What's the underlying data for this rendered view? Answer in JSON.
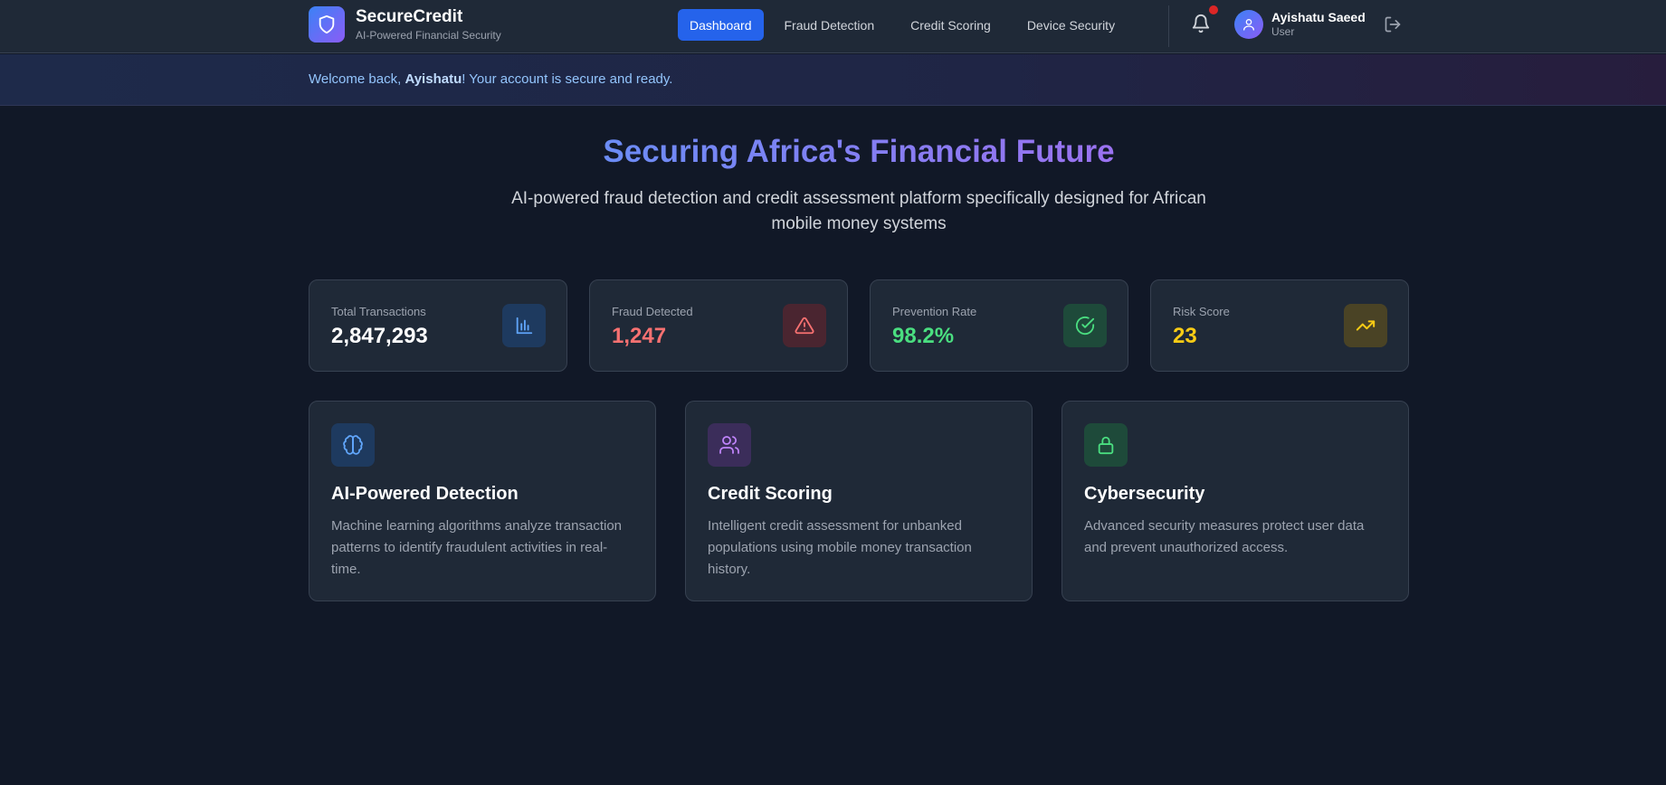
{
  "app": {
    "name": "SecureCredit",
    "tagline": "AI-Powered Financial Security"
  },
  "nav": {
    "items": [
      {
        "label": "Dashboard",
        "active": true
      },
      {
        "label": "Fraud Detection",
        "active": false
      },
      {
        "label": "Credit Scoring",
        "active": false
      },
      {
        "label": "Device Security",
        "active": false
      }
    ]
  },
  "user": {
    "name": "Ayishatu Saeed",
    "role": "User"
  },
  "welcome": {
    "prefix": "Welcome back, ",
    "name": "Ayishatu",
    "suffix": "! Your account is secure and ready."
  },
  "hero": {
    "title": "Securing Africa's Financial Future",
    "subtitle": "AI-powered fraud detection and credit assessment platform specifically designed for African mobile money systems"
  },
  "stats": [
    {
      "label": "Total Transactions",
      "value": "2,847,293",
      "color": "#ffffff",
      "icon": "bar-chart-icon",
      "icon_color": "#60a5fa",
      "icon_bg": "#1e3a5f"
    },
    {
      "label": "Fraud Detected",
      "value": "1,247",
      "color": "#f87171",
      "icon": "alert-triangle-icon",
      "icon_color": "#f87171",
      "icon_bg": "#4a2530"
    },
    {
      "label": "Prevention Rate",
      "value": "98.2%",
      "color": "#4ade80",
      "icon": "check-circle-icon",
      "icon_color": "#4ade80",
      "icon_bg": "#1e4a3a"
    },
    {
      "label": "Risk Score",
      "value": "23",
      "color": "#facc15",
      "icon": "trending-up-icon",
      "icon_color": "#facc15",
      "icon_bg": "#4a4325"
    }
  ],
  "features": [
    {
      "title": "AI-Powered Detection",
      "description": "Machine learning algorithms analyze transaction patterns to identify fraudulent activities in real-time.",
      "icon": "brain-icon",
      "icon_color": "#60a5fa",
      "icon_bg": "#1e3a5f"
    },
    {
      "title": "Credit Scoring",
      "description": "Intelligent credit assessment for unbanked populations using mobile money transaction history.",
      "icon": "users-icon",
      "icon_color": "#c084fc",
      "icon_bg": "#3b2d5a"
    },
    {
      "title": "Cybersecurity",
      "description": "Advanced security measures protect user data and prevent unauthorized access.",
      "icon": "lock-icon",
      "icon_color": "#4ade80",
      "icon_bg": "#1e4a3a"
    }
  ]
}
